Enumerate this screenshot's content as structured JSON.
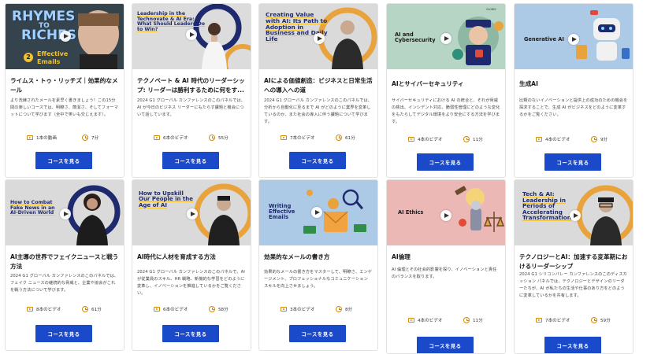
{
  "cards": [
    {
      "title": "ライムス・トゥ・リッチズ｜効果的なメール",
      "desc": "より洗練されたメールを素早く書きましょう！この15分間の楽しいコースでは、明瞭さ、簡潔さ、そしてフォーマットについて学びます（全中で笑いも交じえます）。",
      "videos": "1本の動画",
      "duration": "7分",
      "button": "コースを見る",
      "thumb": {
        "line1": "RHYMES",
        "line2": "TO",
        "line3": "RICHES",
        "badge": "2",
        "sub1": "Effective",
        "sub2": "Emails"
      }
    },
    {
      "title": "テクノベート & AI 時代のリーダーシップ: リーダーは勝利するために何をす...",
      "desc": "2024 G1 グローバル カンファレンスのこのパネルでは、AI が今日のビジネス リーダーにもたらす課題と機会について話しています。",
      "videos": "6本のビデオ",
      "duration": "55分",
      "button": "コースを見る",
      "thumb": {
        "text": "Leadership in the Technovate & AI Era: What Should Leaders Do to Win?"
      }
    },
    {
      "title": "AIによる価値創造：ビジネスと日常生活への導入への道",
      "desc": "2024 G1 グローバル カンファレンスのこのパネルでは、分析から自動化に至るまで AI がどのように業界を変革しているのか、また社会の導入に伴う課題について学びます。",
      "videos": "7本のビデオ",
      "duration": "61分",
      "button": "コースを見る",
      "thumb": {
        "text": "Creating Value with AI: Its Path to Adoption in Business and Daily Life"
      }
    },
    {
      "title": "AIとサイバーセキュリティ",
      "desc": "サイバーセキュリティにおける AI の統合と、それが脅威の検出、インシデント対応、脆弱性管理にどのような変化をもたらしてデジタル環境をより安全にする方法を学びます。",
      "videos": "4本のビデオ",
      "duration": "11分",
      "button": "コースを見る",
      "thumb": {
        "text": "AI and Cybersecurity",
        "logo": "GLOBIS"
      }
    },
    {
      "title": "生成AI",
      "desc": "比類のないイノベーションと提供上の成功のための機会を探求することで、生成 AI がビジネスをどのように変革するかをご覧ください。",
      "videos": "4本のビデオ",
      "duration": "9分",
      "button": "コースを見る",
      "thumb": {
        "text": "Generative AI"
      }
    },
    {
      "title": "AI主導の世界でフェイクニュースと戦う方法",
      "desc": "2024 G1 グローバル カンファレンスのこのパネルでは、フェイク ニュースの継続的な脅威と、企業や協会がこれを戦う方法について学びます。",
      "videos": "8本のビデオ",
      "duration": "61分",
      "button": "コースを見る",
      "thumb": {
        "text": "How to Combat Fake News in an AI-Driven World"
      }
    },
    {
      "title": "AI時代に人材を育成する方法",
      "desc": "2024 G1 グローバル カンファレンスのこのパネルで、AI が従業員のスキル、HR 戦略、新機的な学習をどのように変革し、イノベーションを推進しているかをご覧ください。",
      "videos": "6本のビデオ",
      "duration": "58分",
      "button": "コースを見る",
      "thumb": {
        "text": "How to Upskill Our People in the Age of AI"
      }
    },
    {
      "title": "効果的なメールの書き方",
      "desc": "効果的なメールの書き方をマスターして、明瞭さ、エンゲージメント、プロフェッショナルなコミュニケーション スキルを向上させましょう。",
      "videos": "3本のビデオ",
      "duration": "8分",
      "button": "コースを見る",
      "thumb": {
        "text": "Writing Effective Emails"
      }
    },
    {
      "title": "AI倫理",
      "desc": "AI 倫理とその社会的影響を探り、イノベーションと責任のバランスを取ります。",
      "videos": "4本のビデオ",
      "duration": "11分",
      "button": "コースを見る",
      "thumb": {
        "text": "AI Ethics"
      }
    },
    {
      "title": "テクノロジーとAI：加速する変革期におけるリーダーシップ",
      "desc": "2024 G1 シリコンバレー カンファレンスのこのディスカッション パネルでは、テクノロジーとデザインのリーダーたちが、AI が私たちの生活や仕事のあり方をどのように変革しているかを共有します。",
      "videos": "7本のビデオ",
      "duration": "59分",
      "button": "コースを見る",
      "thumb": {
        "text": "Tech & AI: Leadership in Periods of Accelerating Transformation"
      }
    }
  ],
  "colors": {
    "button": "#1a49c9",
    "icon": "#d48b00",
    "accent_yellow": "#f2c230",
    "accent_orange": "#e8a33c",
    "navy": "#1f2a6e"
  }
}
